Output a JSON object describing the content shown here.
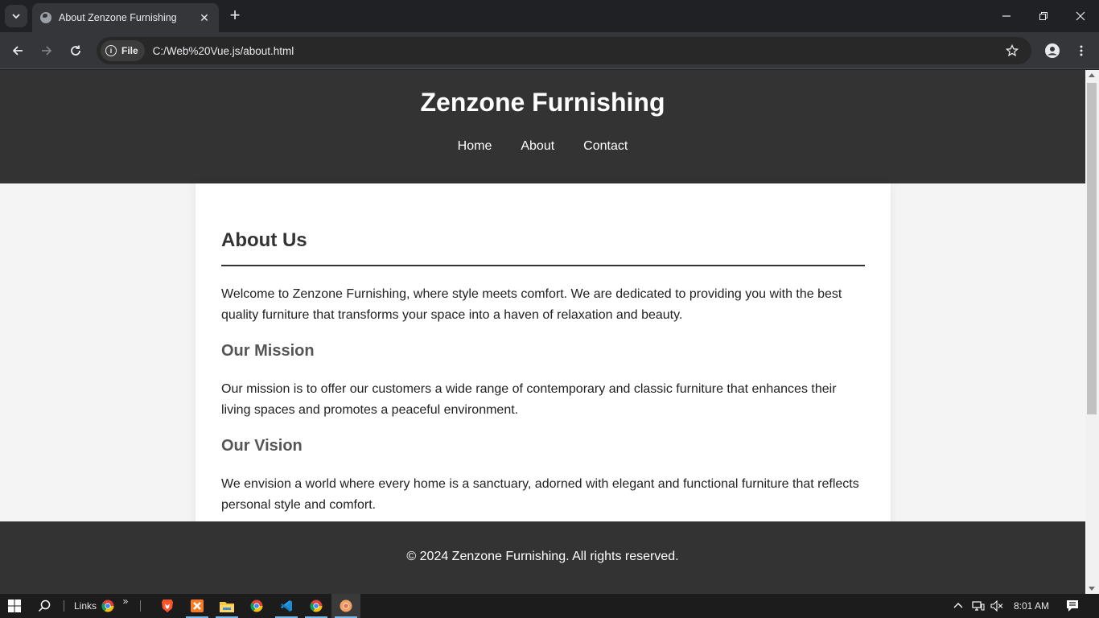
{
  "browser": {
    "tab_title": "About Zenzone Furnishing",
    "new_tab_symbol": "+",
    "close_tab_symbol": "✕",
    "site_info_label": "File",
    "url": "C:/Web%20Vue.js/about.html"
  },
  "site": {
    "title": "Zenzone Furnishing",
    "nav": [
      "Home",
      "About",
      "Contact"
    ],
    "footer": "© 2024 Zenzone Furnishing. All rights reserved."
  },
  "content": {
    "heading": "About Us",
    "intro": "Welcome to Zenzone Furnishing, where style meets comfort. We are dedicated to providing you with the best quality furniture that transforms your space into a haven of relaxation and beauty.",
    "mission_heading": "Our Mission",
    "mission_text": "Our mission is to offer our customers a wide range of contemporary and classic furniture that enhances their living spaces and promotes a peaceful environment.",
    "vision_heading": "Our Vision",
    "vision_text": "We envision a world where every home is a sanctuary, adorned with elegant and functional furniture that reflects personal style and comfort."
  },
  "taskbar": {
    "links_label": "Links",
    "overflow_symbol": "»",
    "time": "8:01 AM",
    "apps": [
      "brave-icon",
      "xampp-icon",
      "file-explorer-icon",
      "chrome-icon",
      "vscode-icon",
      "chrome-dev-icon",
      "chrome-active-icon"
    ]
  },
  "colors": {
    "header_bg": "#333333",
    "page_bg": "#f4f4f4",
    "card_bg": "#ffffff",
    "subheading": "#555555"
  }
}
